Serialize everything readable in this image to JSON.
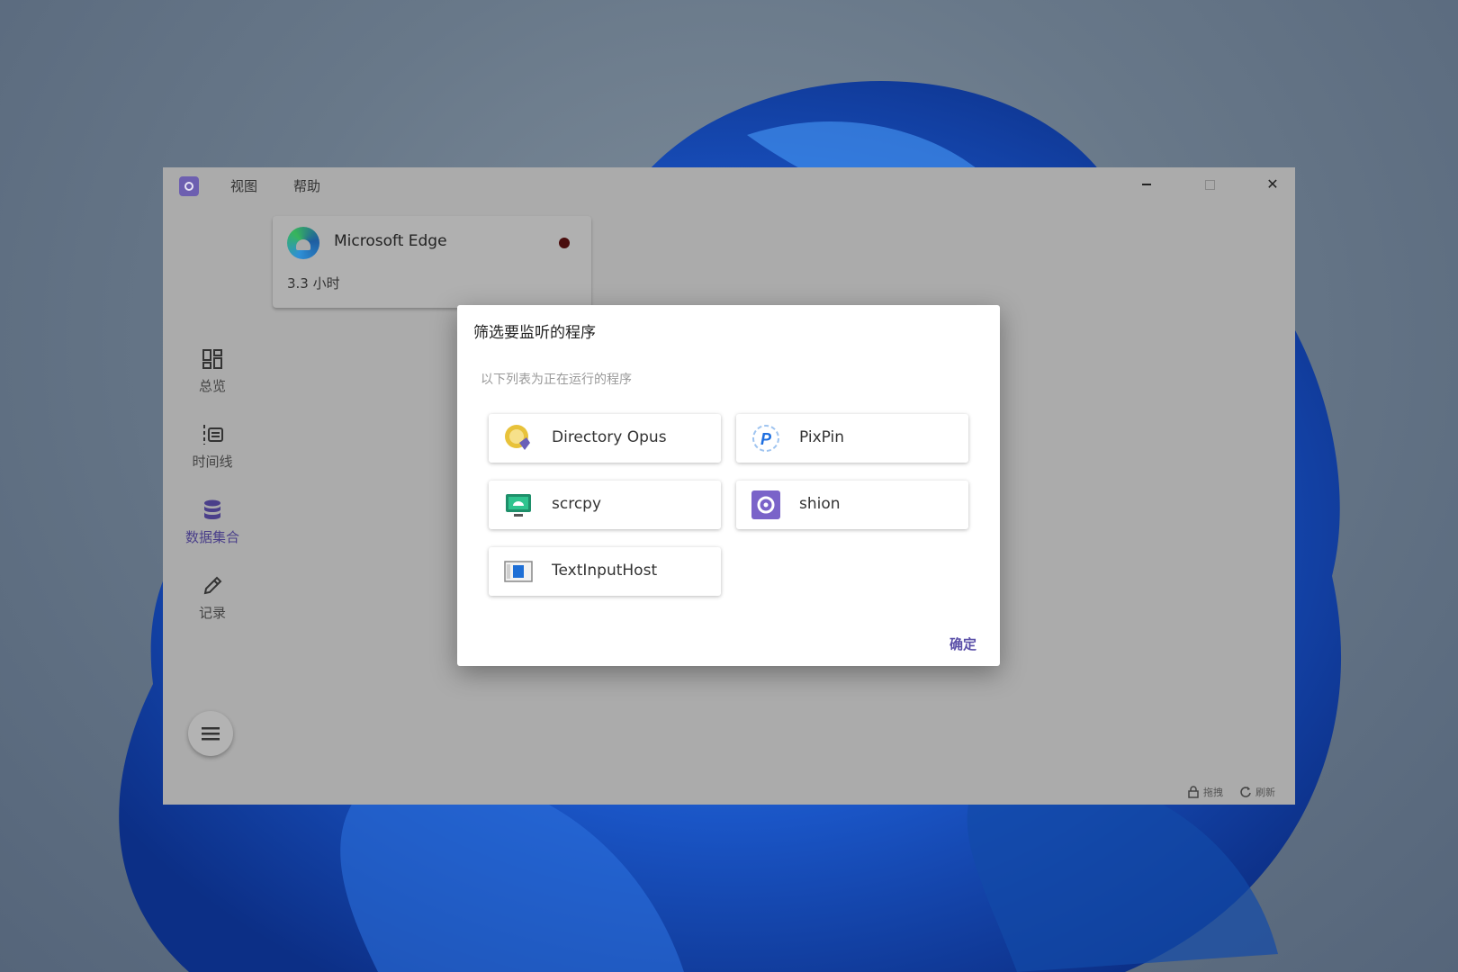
{
  "menu": {
    "view": "视图",
    "help": "帮助"
  },
  "card": {
    "app_name": "Microsoft Edge",
    "duration": "3.3 小时"
  },
  "sidebar": {
    "items": [
      {
        "label": "总览",
        "icon": "dashboard-icon"
      },
      {
        "label": "时间线",
        "icon": "timeline-icon"
      },
      {
        "label": "数据集合",
        "icon": "database-icon",
        "active": true
      },
      {
        "label": "记录",
        "icon": "pencil-icon"
      }
    ]
  },
  "status": {
    "lock_label": "拖拽",
    "refresh_label": "刷新"
  },
  "dialog": {
    "title": "筛选要监听的程序",
    "subtitle": "以下列表为正在运行的程序",
    "programs": [
      {
        "name": "Directory Opus",
        "icon": "directory-opus-icon"
      },
      {
        "name": "PixPin",
        "icon": "pixpin-icon"
      },
      {
        "name": "scrcpy",
        "icon": "scrcpy-icon"
      },
      {
        "name": "shion",
        "icon": "shion-icon"
      },
      {
        "name": "TextInputHost",
        "icon": "textinputhost-icon"
      }
    ],
    "confirm": "确定"
  },
  "colors": {
    "accent": "#5a4fa8",
    "status_dot": "#4a0d0d"
  }
}
